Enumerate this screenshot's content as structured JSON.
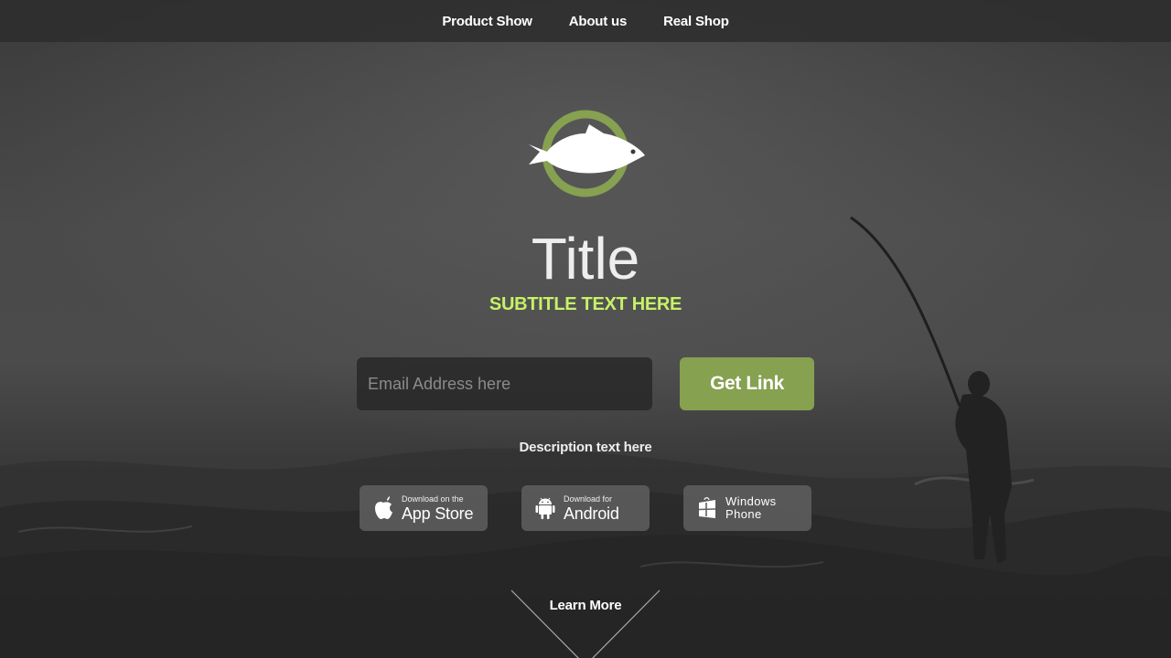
{
  "nav": {
    "items": [
      {
        "label": "Product Show"
      },
      {
        "label": "About us"
      },
      {
        "label": "Real Shop"
      }
    ]
  },
  "logo": {
    "icon": "fish-logo-icon",
    "ring_color": "#86a150"
  },
  "hero": {
    "title": "Title",
    "subtitle": "SUBTITLE TEXT HERE",
    "subtitle_color": "#c6f167"
  },
  "signup": {
    "email_placeholder": "Email Address here",
    "email_value": "",
    "button_label": "Get Link",
    "button_color": "#86a150"
  },
  "description": "Description text here",
  "stores": [
    {
      "icon": "apple-icon",
      "small": "Download on the",
      "big": "App Store"
    },
    {
      "icon": "android-icon",
      "small": "Download for",
      "big": "Android"
    },
    {
      "icon": "windows-icon",
      "line1": "Windows",
      "line2": "Phone"
    }
  ],
  "learn_more": "Learn More"
}
